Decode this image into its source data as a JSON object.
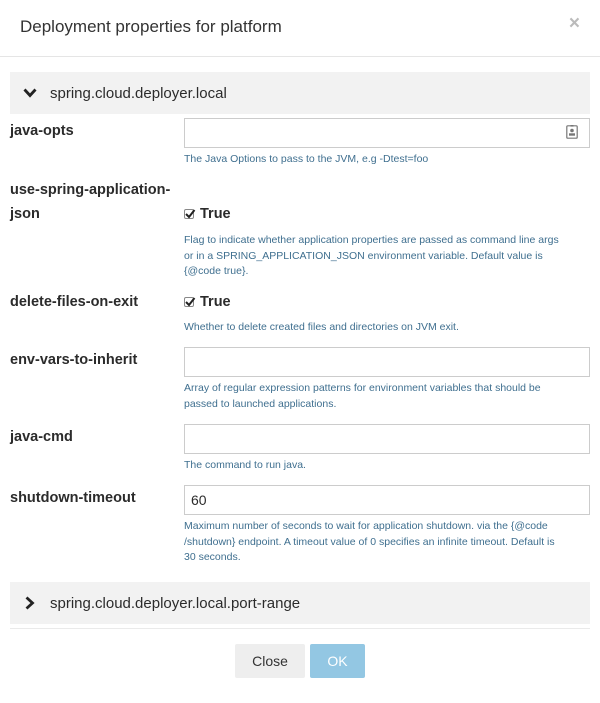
{
  "modal": {
    "title": "Deployment properties for platform",
    "close_glyph": "×"
  },
  "sections": [
    {
      "label": "spring.cloud.deployer.local",
      "expanded": true,
      "icon": "chevron-down-icon"
    },
    {
      "label": "spring.cloud.deployer.local.port-range",
      "expanded": false,
      "icon": "chevron-right-icon"
    }
  ],
  "properties": {
    "java_opts": {
      "label": "java-opts",
      "value": "",
      "description": "The Java Options to pass to the JVM, e.g -Dtest=foo",
      "icon": "contact-card-icon"
    },
    "use_spring_application_json": {
      "label_line1": "use-spring-application-",
      "label_line2": "json",
      "checked": true,
      "check_label": "True",
      "desc_line1": "Flag to indicate whether application properties are passed as command line args",
      "desc_line2": "or in a SPRING_APPLICATION_JSON environment variable. Default value is",
      "desc_line3": "{@code true}."
    },
    "delete_files_on_exit": {
      "label": "delete-files-on-exit",
      "checked": true,
      "check_label": "True",
      "description": "Whether to delete created files and directories on JVM exit."
    },
    "env_vars_to_inherit": {
      "label": "env-vars-to-inherit",
      "value": "",
      "desc_line1": "Array of regular expression patterns for environment variables that should be",
      "desc_line2": "passed to launched applications."
    },
    "java_cmd": {
      "label": "java-cmd",
      "value": "",
      "description": "The command to run java."
    },
    "shutdown_timeout": {
      "label": "shutdown-timeout",
      "value": "60",
      "desc_line1": "Maximum number of seconds to wait for application shutdown. via the {@code",
      "desc_line2": "/shutdown} endpoint. A timeout value of 0 specifies an infinite timeout. Default is",
      "desc_line3": "30 seconds."
    }
  },
  "footer": {
    "close_label": "Close",
    "ok_label": "OK"
  },
  "colors": {
    "description_text": "#3f6f8f",
    "section_bg": "#f2f2f2",
    "ok_button_bg": "#93c7e3"
  }
}
